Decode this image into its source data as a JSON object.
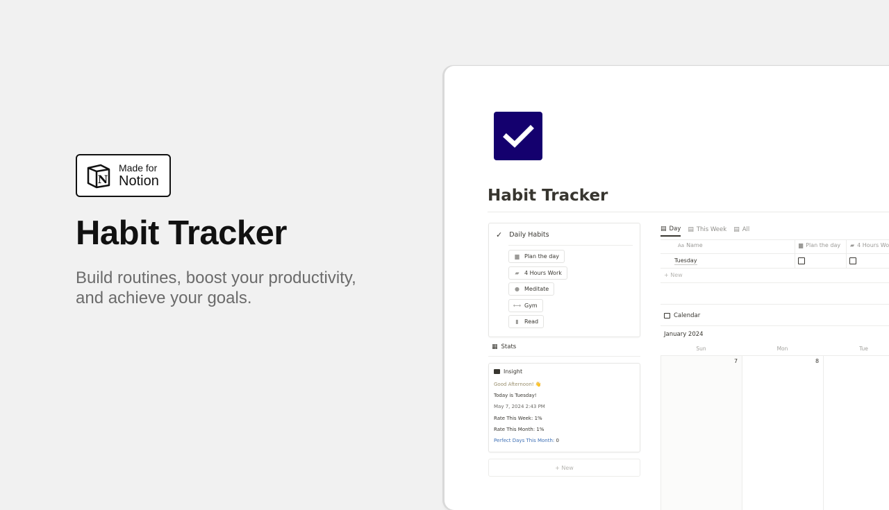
{
  "promo": {
    "badge_line1": "Made for",
    "badge_line2": "Notion",
    "title": "Habit Tracker",
    "subtitle": "Build routines, boost your productivity, and achieve your goals."
  },
  "page": {
    "icon": "checkmark-icon",
    "icon_color": "#14006e",
    "title": "Habit Tracker"
  },
  "daily_habits": {
    "heading": "Daily Habits",
    "items": [
      {
        "label": "Plan the day",
        "icon": "calendar-icon"
      },
      {
        "label": "4 Hours Work",
        "icon": "briefcase-icon"
      },
      {
        "label": "Meditate",
        "icon": "meditate-icon"
      },
      {
        "label": "Gym",
        "icon": "dumbbell-icon"
      },
      {
        "label": "Read",
        "icon": "book-icon"
      }
    ]
  },
  "stats": {
    "heading": "Stats",
    "insight": {
      "heading": "Insight",
      "greeting": "Good Afternoon! 👋",
      "today": "Today is Tuesday!",
      "datetime": "May 7, 2024 2:43 PM",
      "rate_week_label": "Rate This Week:",
      "rate_week_value": "1%",
      "rate_month_label": "Rate This Month:",
      "rate_month_value": "1%",
      "perfect_days_label": "Perfect Days This Month:",
      "perfect_days_value": "0"
    },
    "new_label": "+ New"
  },
  "database": {
    "tabs": [
      {
        "label": "Day",
        "active": true
      },
      {
        "label": "This Week",
        "active": false
      },
      {
        "label": "All",
        "active": false
      }
    ],
    "columns": [
      "Name",
      "Plan the day",
      "4 Hours Wo"
    ],
    "name_prefix": "Aa",
    "rows": [
      {
        "name": "Tuesday",
        "plan_the_day": false,
        "four_hours_work": false
      }
    ],
    "new_label": "+ New"
  },
  "calendar": {
    "heading": "Calendar",
    "month": "January 2024",
    "weekdays": [
      "Sun",
      "Mon",
      "Tue"
    ],
    "days": [
      "7",
      "8"
    ]
  }
}
